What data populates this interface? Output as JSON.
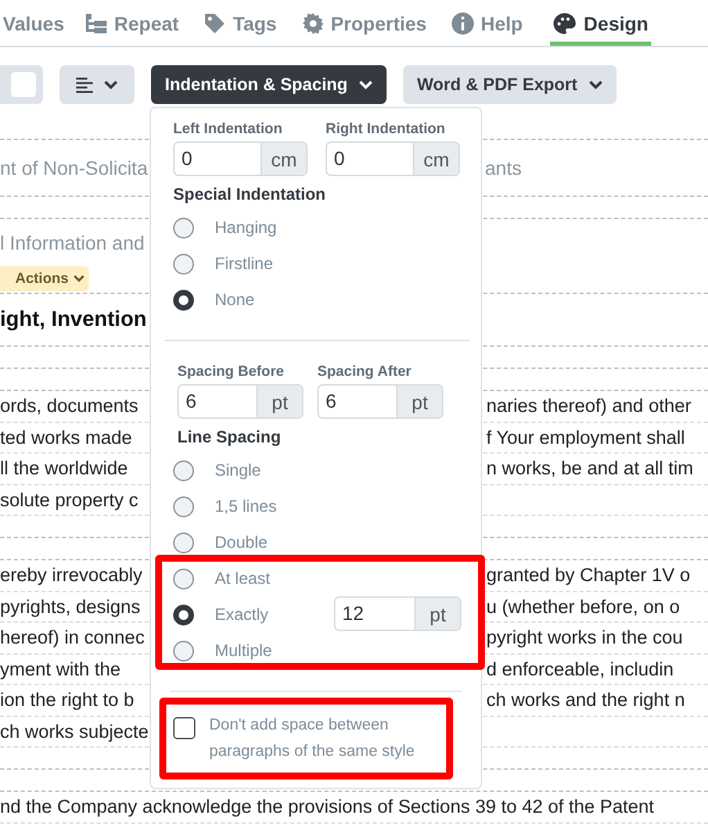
{
  "tabs": [
    {
      "label": "Values",
      "selected": false
    },
    {
      "label": "Repeat",
      "selected": false
    },
    {
      "label": "Tags",
      "selected": false
    },
    {
      "label": "Properties",
      "selected": false
    },
    {
      "label": "Help",
      "selected": false
    },
    {
      "label": "Design",
      "selected": true
    }
  ],
  "toolbar": [
    {
      "kind": "swatch"
    },
    {
      "kind": "align",
      "expanded": false
    },
    {
      "kind": "menu",
      "label": "Indentation & Spacing",
      "expanded": true
    },
    {
      "kind": "menu",
      "label": "Word & PDF Export",
      "expanded": false
    }
  ],
  "document": [
    {
      "kind": "space"
    },
    {
      "kind": "muted",
      "left": "nt of Non-Solicita",
      "right": "ants"
    },
    {
      "kind": "space"
    },
    {
      "kind": "muted",
      "left": "l Information and"
    },
    {
      "kind": "badge",
      "left": "Actions"
    },
    {
      "kind": "heading",
      "left": "ight, Invention"
    },
    {
      "kind": "space"
    },
    {
      "kind": "space"
    },
    {
      "kind": "text",
      "left": "ords, documents",
      "right": "naries thereof) and other"
    },
    {
      "kind": "text",
      "left": "ted works made",
      "right": "f Your employment shall"
    },
    {
      "kind": "text",
      "left": "ll the worldwide",
      "right": "n works, be and at all tim"
    },
    {
      "kind": "text",
      "left": "solute property c"
    },
    {
      "kind": "space"
    },
    {
      "kind": "space"
    },
    {
      "kind": "text",
      "left": "ereby irrevocably",
      "right": "granted by Chapter 1V o"
    },
    {
      "kind": "text",
      "left": "pyrights, designs",
      "right": "u (whether before, on o"
    },
    {
      "kind": "text",
      "left": "hereof) in connec",
      "right": "pyright works in the cou"
    },
    {
      "kind": "text",
      "left": "yment with the",
      "right": "d enforceable, includin"
    },
    {
      "kind": "text",
      "left": "ion the right to b",
      "right": "ch works and the right n"
    },
    {
      "kind": "text",
      "left": "ch works subjecte"
    },
    {
      "kind": "space"
    },
    {
      "kind": "space"
    },
    {
      "kind": "text",
      "left": "nd the Company acknowledge the provisions of Sections 39 to 42 of the Patent"
    }
  ],
  "panel": {
    "indentation": [
      {
        "label": "Left Indentation",
        "value": "0",
        "unit": "cm"
      },
      {
        "label": "Right Indentation",
        "value": "0",
        "unit": "cm"
      }
    ],
    "special_title": "Special Indentation",
    "special": [
      {
        "label": "Hanging",
        "selected": false
      },
      {
        "label": "Firstline",
        "selected": false
      },
      {
        "label": "None",
        "selected": true
      }
    ],
    "spacing": [
      {
        "label": "Spacing Before",
        "value": "6",
        "unit": "pt"
      },
      {
        "label": "Spacing After",
        "value": "6",
        "unit": "pt"
      }
    ],
    "line_title": "Line Spacing",
    "line": [
      {
        "label": "Single",
        "selected": false
      },
      {
        "label": "1,5 lines",
        "selected": false
      },
      {
        "label": "Double",
        "selected": false
      },
      {
        "label": "At least",
        "selected": false
      },
      {
        "label": "Exactly",
        "selected": true,
        "value": "12",
        "unit": "pt"
      },
      {
        "label": "Multiple",
        "selected": false
      }
    ],
    "no_space": {
      "label": "Don't add space between paragraphs of the same style",
      "checked": false
    }
  }
}
